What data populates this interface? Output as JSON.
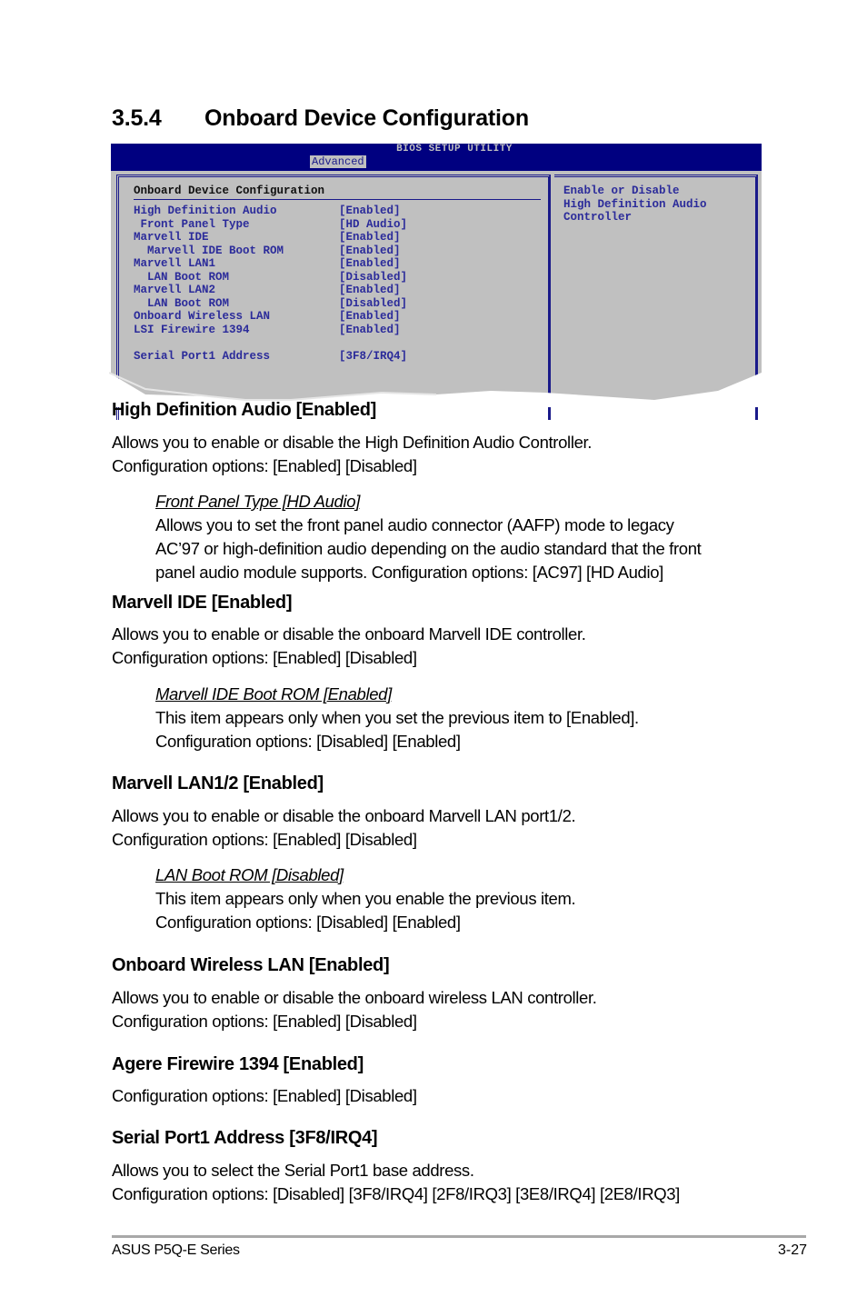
{
  "section": {
    "number": "3.5.4",
    "title": "Onboard Device Configuration"
  },
  "bios": {
    "utility_title": "BIOS SETUP UTILITY",
    "active_tab": "Advanced",
    "panel_title": "Onboard Device Configuration",
    "colors": {
      "header": "#000080",
      "body": "#c0c0c0",
      "text": "#2b2b9a"
    },
    "items": [
      {
        "label": "High Definition Audio",
        "value": "[Enabled]",
        "indent": 0
      },
      {
        "label": " Front Panel Type",
        "value": "[HD Audio]",
        "indent": 1
      },
      {
        "label": "Marvell IDE",
        "value": "[Enabled]",
        "indent": 0
      },
      {
        "label": "  Marvell IDE Boot ROM",
        "value": "[Enabled]",
        "indent": 2
      },
      {
        "label": "Marvell LAN1",
        "value": "[Enabled]",
        "indent": 0
      },
      {
        "label": "  LAN Boot ROM",
        "value": "[Disabled]",
        "indent": 2
      },
      {
        "label": "Marvell LAN2",
        "value": "[Enabled]",
        "indent": 0
      },
      {
        "label": "  LAN Boot ROM",
        "value": "[Disabled]",
        "indent": 2
      },
      {
        "label": "Onboard Wireless LAN",
        "value": "[Enabled]",
        "indent": 0
      },
      {
        "label": "LSI Firewire 1394",
        "value": "[Enabled]",
        "indent": 0
      },
      {
        "label": "Serial Port1 Address",
        "value": "[3F8/IRQ4]",
        "indent": 0
      }
    ],
    "help_text": [
      "Enable or Disable",
      "High Definition Audio",
      "Controller"
    ]
  },
  "content": {
    "hda": {
      "heading": "High Definition Audio [Enabled]",
      "lines": [
        "Allows you to enable or disable the High Definition Audio Controller.",
        "Configuration options: [Enabled] [Disabled]"
      ],
      "sub": {
        "title": "Front Panel Type [HD Audio]",
        "lines": [
          "Allows you to set the front panel audio connector (AAFP) mode to legacy",
          "AC’97 or high-definition audio depending on the audio standard that the front",
          "panel audio module supports. Configuration options: [AC97] [HD Audio]"
        ]
      }
    },
    "ide": {
      "heading": "Marvell IDE [Enabled]",
      "lines": [
        "Allows you to enable or disable the onboard Marvell IDE controller.",
        "Configuration options: [Enabled] [Disabled]"
      ],
      "sub": {
        "title": "Marvell IDE Boot ROM [Enabled]",
        "lines": [
          "This item appears only when you set the previous item to [Enabled].",
          "Configuration options: [Disabled] [Enabled]"
        ]
      }
    },
    "lan": {
      "heading": "Marvell LAN1/2 [Enabled]",
      "lines": [
        "Allows you to enable or disable the onboard Marvell LAN port1/2.",
        "Configuration options: [Enabled] [Disabled]"
      ],
      "sub": {
        "title": "LAN Boot ROM [Disabled]",
        "lines": [
          "This item appears only when you enable the previous item.",
          "Configuration options: [Disabled] [Enabled]"
        ]
      }
    },
    "wlan": {
      "heading": "Onboard Wireless LAN [Enabled]",
      "lines": [
        "Allows you to enable or disable the onboard wireless LAN controller.",
        "Configuration options: [Enabled] [Disabled]"
      ]
    },
    "firewire": {
      "heading": "Agere Firewire 1394 [Enabled]",
      "lines": [
        "Configuration options: [Enabled] [Disabled]"
      ]
    },
    "serial": {
      "heading": "Serial Port1 Address [3F8/IRQ4]",
      "lines": [
        "Allows you to select the Serial Port1 base address.",
        "Configuration options: [Disabled] [3F8/IRQ4] [2F8/IRQ3] [3E8/IRQ4] [2E8/IRQ3]"
      ]
    }
  },
  "footer": {
    "product": "ASUS P5Q-E Series",
    "page": "3-27"
  }
}
